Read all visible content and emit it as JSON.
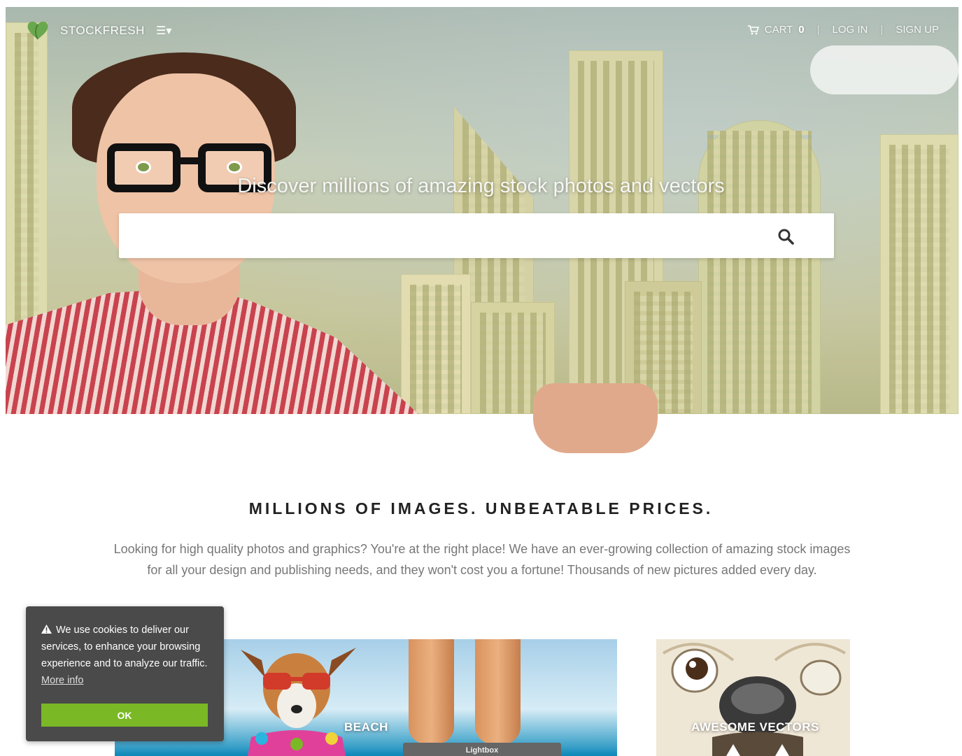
{
  "nav": {
    "brand": "STOCKFRESH",
    "menu_icon": "hamburger-icon",
    "cart_label": "CART",
    "cart_count": "0",
    "login_label": "LOG IN",
    "signup_label": "SIGN UP",
    "separator": "|"
  },
  "hero": {
    "title": "Discover millions of amazing stock photos and vectors",
    "search_placeholder": "",
    "search_icon": "magnifier-icon"
  },
  "content": {
    "title": "MILLIONS OF IMAGES. UNBEATABLE PRICES.",
    "description": "Looking for high quality photos and graphics? You're at the right place! We have an ever-growing collection of amazing stock images for all your design and publishing needs, and they won't cost you a fortune! Thousands of new pictures added every day."
  },
  "tiles": [
    {
      "label": "BEACH"
    },
    {
      "label": "AWESOME VECTORS"
    }
  ],
  "lightbox": {
    "label": "Lightbox"
  },
  "cookie": {
    "text": "We use cookies to deliver our services, to enhance your browsing experience and to analyze our traffic.",
    "more_info": "More info",
    "ok_label": "OK"
  },
  "colors": {
    "accent_green": "#7ab825",
    "cookie_bg": "#4a4a4a"
  }
}
